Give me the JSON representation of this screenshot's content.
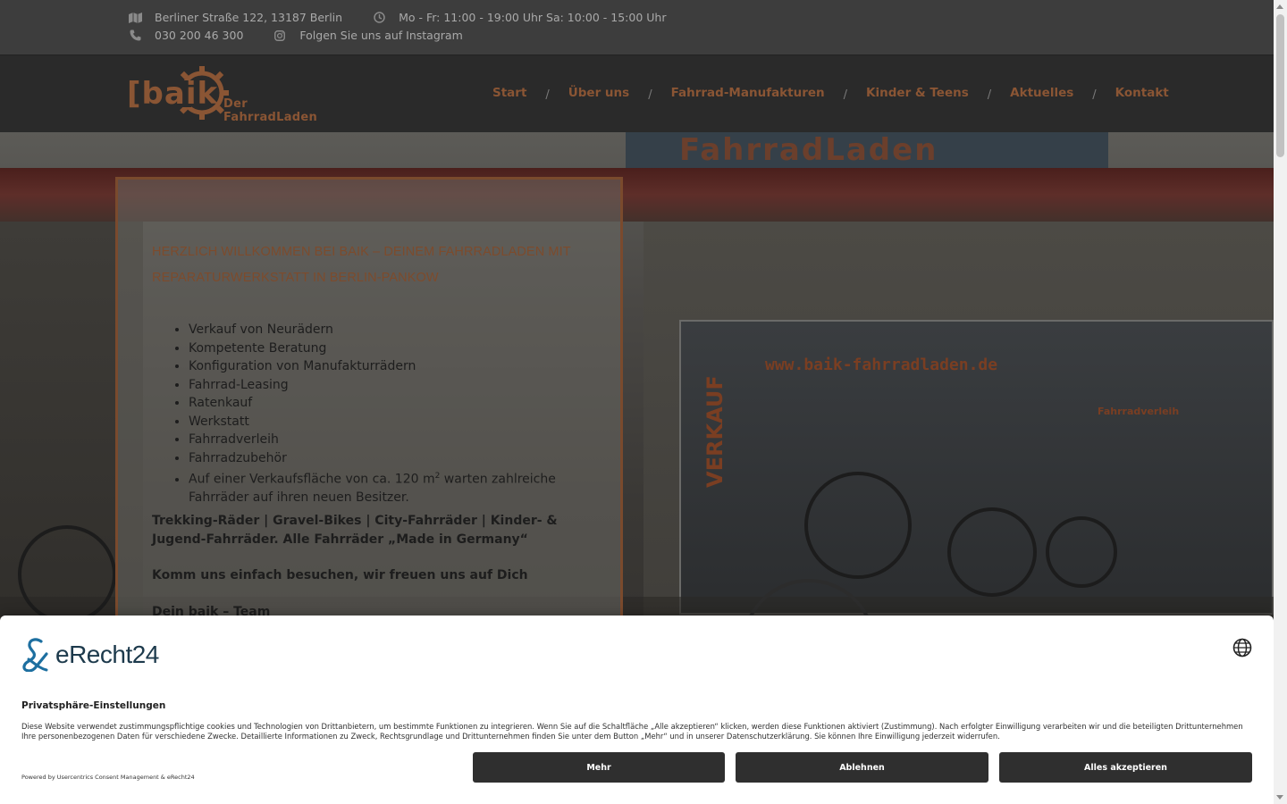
{
  "topbar": {
    "address": "Berliner Straße 122, 13187 Berlin",
    "hours": "Mo - Fr: 11:00 - 19:00 Uhr Sa: 10:00 - 15:00 Uhr",
    "phone": "030 200 46 300",
    "instagram": "Folgen Sie uns auf Instagram",
    "icons": [
      "map-icon",
      "clock-icon",
      "phone-icon",
      "instagram-icon"
    ]
  },
  "logo": {
    "wordmark": "[baik",
    "subtitle": "Der FahrradLaden"
  },
  "nav": {
    "items": [
      "Start",
      "Über uns",
      "Fahrrad-Manufakturen",
      "Kinder & Teens",
      "Aktuelles",
      "Kontakt"
    ],
    "separator": "/"
  },
  "hero": {
    "shop_sign": "FahrradLaden",
    "url_sign": "www.baik-fahrradladen.de",
    "verkauf_sign": "VERKAUF",
    "verleih_sign": "Fahrradverleih"
  },
  "welcome": {
    "title": "Herzlich Willkommen bei baik – Deinem Fahrradladen mit Reparaturwerkstatt in Berlin-Pankow",
    "list": [
      "Verkauf von Neurädern",
      "Kompetente Beratung",
      "Konfiguration von Manufakturrädern",
      "Fahrrad-Leasing",
      "Ratenkauf",
      "Werkstatt",
      "Fahrradverleih",
      "Fahrradzubehör"
    ],
    "area_pre": "Auf einer Verkaufsfläche von ca. 120 m",
    "area_sup": "2",
    "area_post": " warten zahlreiche Fahrräder auf ihren neuen Besitzer.",
    "bikes": "Trekking-Räder | Gravel-Bikes | City-Fahrräder | Kinder- & Jugend-Fahrräder.  Alle Fahrräder „Made in Germany“",
    "visit": "Komm uns einfach besuchen, wir freuen uns auf Dich",
    "team": "Dein baik – Team"
  },
  "cookie": {
    "brand": "eRecht24",
    "heading": "Privatsphäre-Einstellungen",
    "description": "Diese Website verwendet zustimmungspflichtige cookies und Technologien von Drittanbietern, um bestimmte Funktionen zu integrieren. Wenn Sie auf die Schaltfläche „Alle akzeptieren“ klicken, werden diese Funktionen aktiviert (Zustimmung). Nach erfolgter Einwilligung verarbeiten wir und die beteiligten Drittunternehmen Ihre personenbezogenen Daten für verschiedene Zwecke. Detaillierte Informationen zu Zweck, Rechtsgrundlage und Drittunternehmen finden Sie unter dem Button „Mehr“ und in unserer Datenschutzerklärung. Sie können Ihre Einwilligung jederzeit widerrufen.",
    "powered": "Powered by Usercentrics Consent Management & eRecht24",
    "btn_more": "Mehr",
    "btn_decline": "Ablehnen",
    "btn_accept": "Alles akzeptieren"
  },
  "colors": {
    "accent": "#8a5534",
    "topbar_bg": "#3d3d3d",
    "header_bg": "#2a2a2a",
    "button_bg": "#2f2f2f",
    "brand_teal": "#1d6fa0"
  }
}
